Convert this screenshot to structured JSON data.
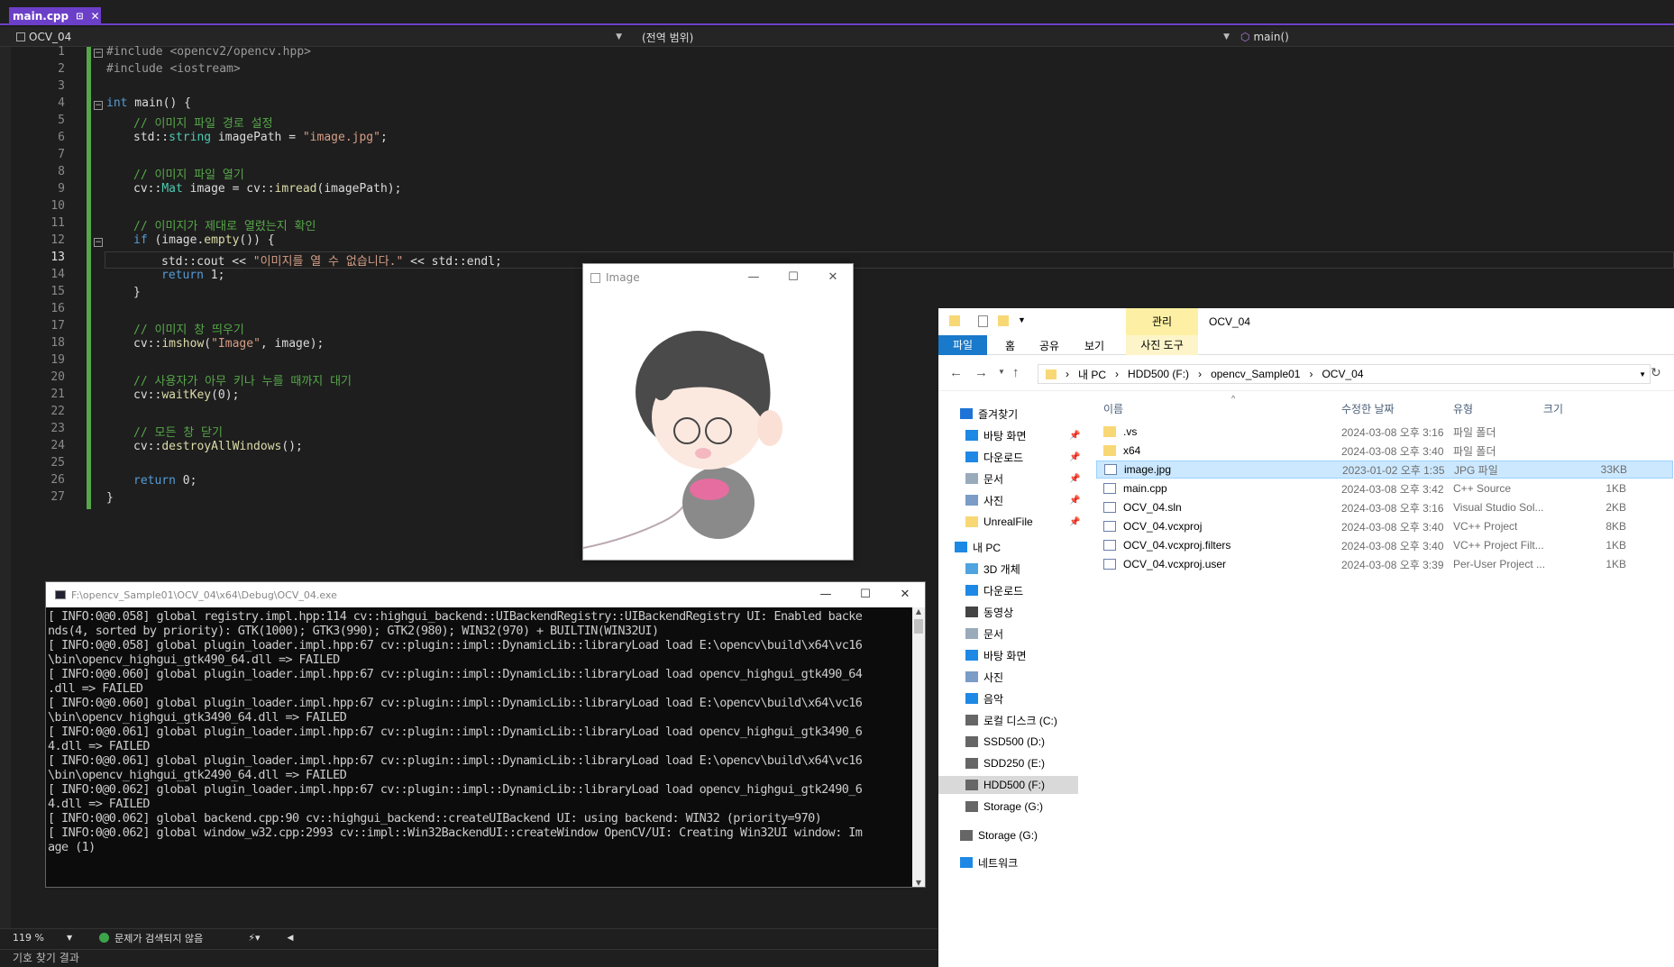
{
  "editor": {
    "tab": {
      "filename": "main.cpp",
      "pin": "⊡",
      "close": "✕"
    },
    "nav": {
      "project": "OCV_04",
      "scope": "(전역 범위)",
      "member": "main()"
    },
    "lines": [
      "1",
      "2",
      "3",
      "4",
      "5",
      "6",
      "7",
      "8",
      "9",
      "10",
      "11",
      "12",
      "13",
      "14",
      "15",
      "16",
      "17",
      "18",
      "19",
      "20",
      "21",
      "22",
      "23",
      "24",
      "25",
      "26",
      "27"
    ],
    "code": {
      "l1": "#include <opencv2/opencv.hpp>",
      "l2": "#include <iostream>",
      "l4a": "int",
      "l4b": " main() {",
      "l5": "// 이미지 파일 경로 설정",
      "l6a": "std::",
      "l6b": "string",
      "l6c": " imagePath = ",
      "l6d": "\"image.jpg\"",
      "l6e": ";",
      "l8": "// 이미지 파일 열기",
      "l9a": "cv::",
      "l9b": "Mat",
      "l9c": " image = cv::",
      "l9d": "imread",
      "l9e": "(imagePath);",
      "l11": "// 이미지가 제대로 열렸는지 확인",
      "l12a": "if",
      "l12b": " (image.",
      "l12c": "empty",
      "l12d": "()) {",
      "l13a": "std::cout << ",
      "l13b": "\"이미지를 열 수 없습니다.\"",
      "l13c": " << std::endl;",
      "l14a": "return",
      "l14b": " 1;",
      "l15": "}",
      "l17": "// 이미지 창 띄우기",
      "l18a": "cv::",
      "l18b": "imshow",
      "l18c": "(",
      "l18d": "\"Image\"",
      "l18e": ", image);",
      "l20": "// 사용자가 아무 키나 누를 때까지 대기",
      "l21a": "cv::",
      "l21b": "waitKey",
      "l21c": "(0);",
      "l23": "// 모든 창 닫기",
      "l24a": "cv::",
      "l24b": "destroyAllWindows",
      "l24c": "();",
      "l26a": "return",
      "l26b": " 0;",
      "l27": "}"
    }
  },
  "status": {
    "zoom": "119 %",
    "issues": "문제가 검색되지 않음"
  },
  "output_panel": {
    "title": "기호 찾기 결과"
  },
  "image_window": {
    "title": "Image"
  },
  "console": {
    "title": "F:\\opencv_Sample01\\OCV_04\\x64\\Debug\\OCV_04.exe",
    "text": "[ INFO:0@0.058] global registry.impl.hpp:114 cv::highgui_backend::UIBackendRegistry::UIBackendRegistry UI: Enabled backe\nnds(4, sorted by priority): GTK(1000); GTK3(990); GTK2(980); WIN32(970) + BUILTIN(WIN32UI)\n[ INFO:0@0.058] global plugin_loader.impl.hpp:67 cv::plugin::impl::DynamicLib::libraryLoad load E:\\opencv\\build\\x64\\vc16\n\\bin\\opencv_highgui_gtk490_64.dll => FAILED\n[ INFO:0@0.060] global plugin_loader.impl.hpp:67 cv::plugin::impl::DynamicLib::libraryLoad load opencv_highgui_gtk490_64\n.dll => FAILED\n[ INFO:0@0.060] global plugin_loader.impl.hpp:67 cv::plugin::impl::DynamicLib::libraryLoad load E:\\opencv\\build\\x64\\vc16\n\\bin\\opencv_highgui_gtk3490_64.dll => FAILED\n[ INFO:0@0.061] global plugin_loader.impl.hpp:67 cv::plugin::impl::DynamicLib::libraryLoad load opencv_highgui_gtk3490_6\n4.dll => FAILED\n[ INFO:0@0.061] global plugin_loader.impl.hpp:67 cv::plugin::impl::DynamicLib::libraryLoad load E:\\opencv\\build\\x64\\vc16\n\\bin\\opencv_highgui_gtk2490_64.dll => FAILED\n[ INFO:0@0.062] global plugin_loader.impl.hpp:67 cv::plugin::impl::DynamicLib::libraryLoad load opencv_highgui_gtk2490_6\n4.dll => FAILED\n[ INFO:0@0.062] global backend.cpp:90 cv::highgui_backend::createUIBackend UI: using backend: WIN32 (priority=970)\n[ INFO:0@0.062] global window_w32.cpp:2993 cv::impl::Win32BackendUI::createWindow OpenCV/UI: Creating Win32UI window: Im\nage (1)"
  },
  "explorer": {
    "contextual_tab": "관리",
    "title": "OCV_04",
    "tabs": [
      "파일",
      "홈",
      "공유",
      "보기",
      "사진 도구"
    ],
    "path": [
      "내 PC",
      "HDD500 (F:)",
      "opencv_Sample01",
      "OCV_04"
    ],
    "nav": [
      {
        "label": "즐겨찾기",
        "icon": "star-icon",
        "color": "#1e74d6"
      },
      {
        "label": "바탕 화면",
        "icon": "desktop-icon",
        "color": "#1e88e5",
        "pin": true
      },
      {
        "label": "다운로드",
        "icon": "download-icon",
        "color": "#1e88e5",
        "pin": true
      },
      {
        "label": "문서",
        "icon": "document-icon",
        "color": "#9ab",
        "pin": true
      },
      {
        "label": "사진",
        "icon": "pictures-icon",
        "color": "#7a9cc6",
        "pin": true
      },
      {
        "label": "UnrealFile",
        "icon": "folder-icon",
        "color": "#f8d775",
        "pin": true
      },
      {
        "label": "내 PC",
        "icon": "pc-icon",
        "color": "#1e88e5"
      },
      {
        "label": "3D 개체",
        "icon": "3d-icon",
        "color": "#4fa3e0"
      },
      {
        "label": "다운로드",
        "icon": "download-icon",
        "color": "#1e88e5"
      },
      {
        "label": "동영상",
        "icon": "video-icon",
        "color": "#444"
      },
      {
        "label": "문서",
        "icon": "document-icon",
        "color": "#9ab"
      },
      {
        "label": "바탕 화면",
        "icon": "desktop-icon",
        "color": "#1e88e5"
      },
      {
        "label": "사진",
        "icon": "pictures-icon",
        "color": "#7a9cc6"
      },
      {
        "label": "음악",
        "icon": "music-icon",
        "color": "#1e88e5"
      },
      {
        "label": "로컬 디스크 (C:)",
        "icon": "drive-icon",
        "color": "#666"
      },
      {
        "label": "SSD500 (D:)",
        "icon": "drive-icon",
        "color": "#666"
      },
      {
        "label": "SDD250 (E:)",
        "icon": "drive-icon",
        "color": "#666"
      },
      {
        "label": "HDD500 (F:)",
        "icon": "drive-icon",
        "color": "#666"
      },
      {
        "label": "Storage (G:)",
        "icon": "drive-icon",
        "color": "#666"
      },
      {
        "label": "Storage (G:)",
        "icon": "drive-icon",
        "color": "#666"
      },
      {
        "label": "네트워크",
        "icon": "network-icon",
        "color": "#1e88e5"
      }
    ],
    "columns": {
      "name": "이름",
      "date": "수정한 날짜",
      "type": "유형",
      "size": "크기"
    },
    "files": [
      {
        "name": ".vs",
        "date": "2024-03-08 오후 3:16",
        "type": "파일 폴더",
        "size": "",
        "icon": "folder-icon"
      },
      {
        "name": "x64",
        "date": "2024-03-08 오후 3:40",
        "type": "파일 폴더",
        "size": "",
        "icon": "folder-icon"
      },
      {
        "name": "image.jpg",
        "date": "2023-01-02 오후 1:35",
        "type": "JPG 파일",
        "size": "33KB",
        "icon": "image-file-icon"
      },
      {
        "name": "main.cpp",
        "date": "2024-03-08 오후 3:42",
        "type": "C++ Source",
        "size": "1KB",
        "icon": "cpp-file-icon"
      },
      {
        "name": "OCV_04.sln",
        "date": "2024-03-08 오후 3:16",
        "type": "Visual Studio Sol...",
        "size": "2KB",
        "icon": "sln-file-icon"
      },
      {
        "name": "OCV_04.vcxproj",
        "date": "2024-03-08 오후 3:40",
        "type": "VC++ Project",
        "size": "8KB",
        "icon": "vcxproj-file-icon"
      },
      {
        "name": "OCV_04.vcxproj.filters",
        "date": "2024-03-08 오후 3:40",
        "type": "VC++ Project Filt...",
        "size": "1KB",
        "icon": "filters-file-icon"
      },
      {
        "name": "OCV_04.vcxproj.user",
        "date": "2024-03-08 오후 3:39",
        "type": "Per-User Project ...",
        "size": "1KB",
        "icon": "user-file-icon"
      }
    ]
  },
  "colors": {
    "accent": "#6c3fc8",
    "selection": "#cce8ff",
    "ribbon_file": "#1979ca",
    "contextual": "#fdf0a4"
  }
}
